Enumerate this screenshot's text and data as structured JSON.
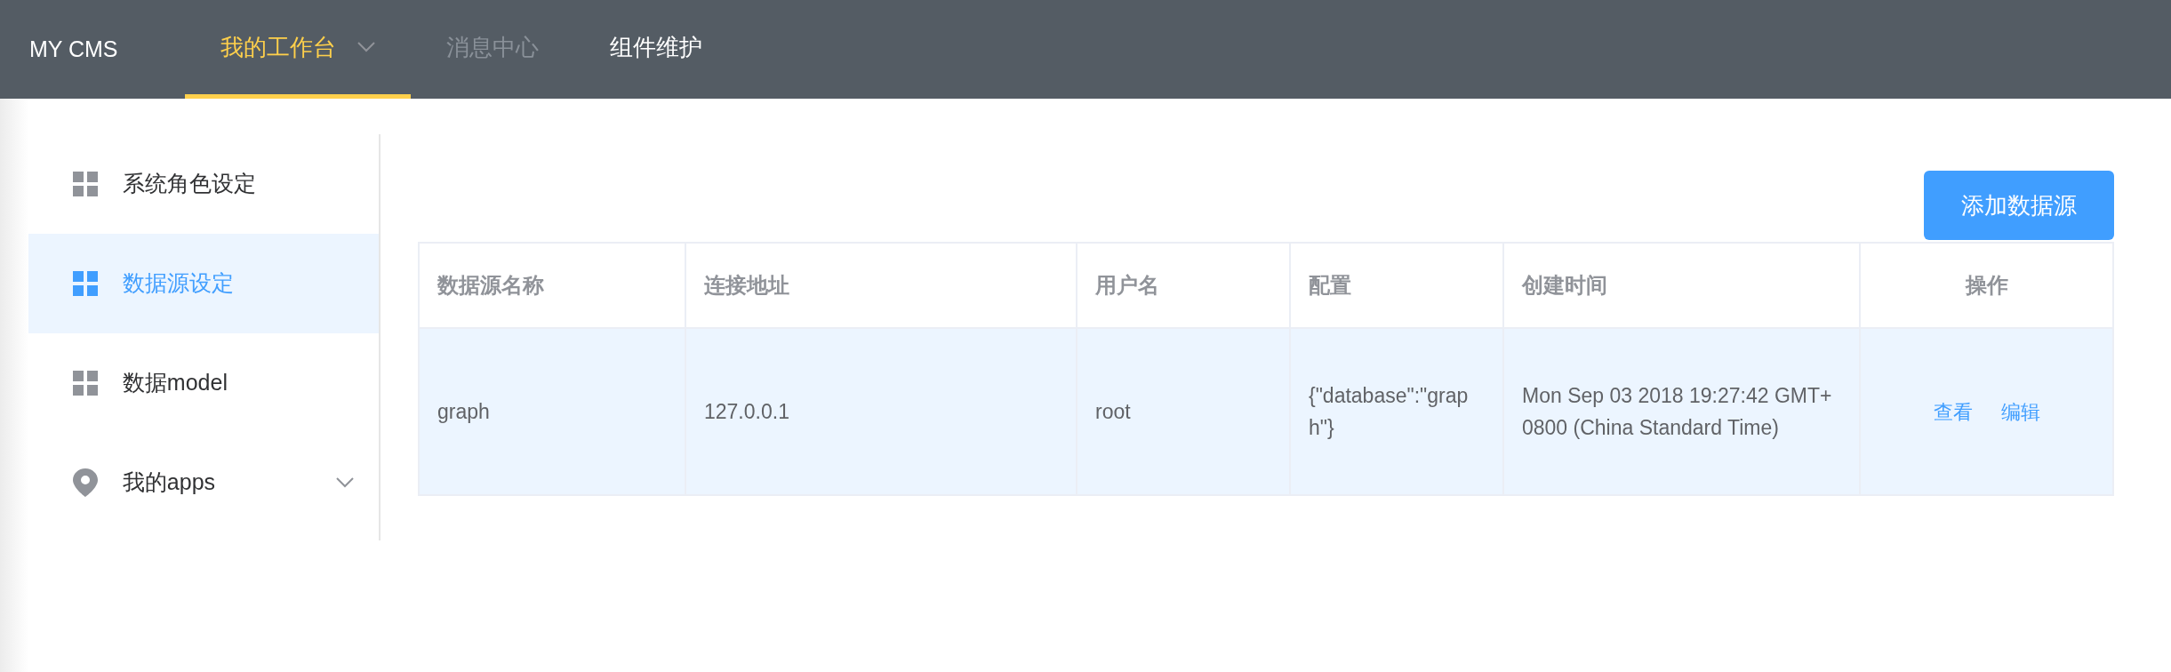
{
  "navbar": {
    "brand": "MY CMS",
    "tabs": [
      {
        "label": "我的工作台",
        "selected": true,
        "disabled": false,
        "dropdown": true
      },
      {
        "label": "消息中心",
        "selected": false,
        "disabled": true,
        "dropdown": false
      },
      {
        "label": "组件维护",
        "selected": false,
        "disabled": false,
        "dropdown": false
      }
    ]
  },
  "sidebar": {
    "items": [
      {
        "label": "系统角色设定",
        "kind": "grid",
        "selected": false
      },
      {
        "label": "数据源设定",
        "kind": "grid",
        "selected": true
      },
      {
        "label": "数据model",
        "kind": "grid",
        "selected": false
      },
      {
        "label": "我的apps",
        "kind": "pin",
        "selected": false,
        "expanded": false
      }
    ]
  },
  "add_button": "添加数据源",
  "table": {
    "columns": [
      "数据源名称",
      "连接地址",
      "用户名",
      "配置",
      "创建时间",
      "操作"
    ],
    "rows": [
      {
        "selected": true,
        "cells": [
          "graph",
          "127.0.0.1",
          "root",
          "{\"database\":\"graph\"}",
          "Mon Sep 03 2018 19:27:42 GMT+0800 (China Standard Time)"
        ],
        "actions": [
          "查看",
          "编辑"
        ]
      }
    ]
  }
}
